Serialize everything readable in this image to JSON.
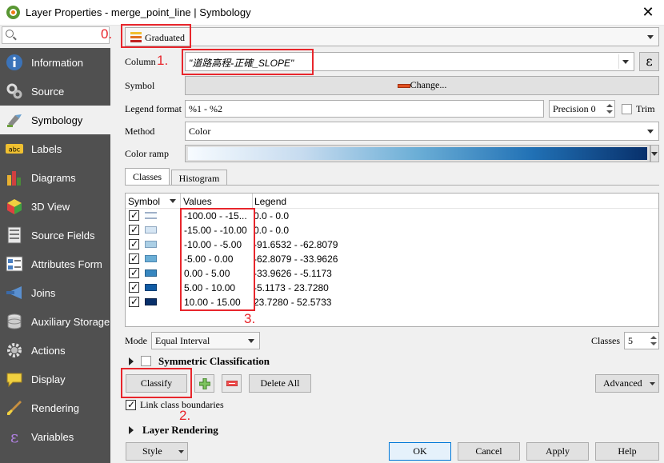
{
  "window": {
    "title": "Layer Properties - merge_point_line | Symbology",
    "close": "✕"
  },
  "search": {
    "placeholder": ""
  },
  "sidebar": {
    "items": [
      {
        "label": "Information",
        "icon": "info-icon"
      },
      {
        "label": "Source",
        "icon": "source-icon"
      },
      {
        "label": "Symbology",
        "icon": "symbology-icon",
        "active": true
      },
      {
        "label": "Labels",
        "icon": "labels-icon"
      },
      {
        "label": "Diagrams",
        "icon": "diagrams-icon"
      },
      {
        "label": "3D View",
        "icon": "cube-icon"
      },
      {
        "label": "Source Fields",
        "icon": "fields-icon"
      },
      {
        "label": "Attributes Form",
        "icon": "form-icon"
      },
      {
        "label": "Joins",
        "icon": "joins-icon"
      },
      {
        "label": "Auxiliary Storage",
        "icon": "storage-icon"
      },
      {
        "label": "Actions",
        "icon": "gear-icon"
      },
      {
        "label": "Display",
        "icon": "display-icon"
      },
      {
        "label": "Rendering",
        "icon": "brush-icon"
      },
      {
        "label": "Variables",
        "icon": "epsilon-icon"
      }
    ]
  },
  "renderer": {
    "type": "Graduated"
  },
  "form": {
    "column_label": "Column",
    "column_value": "\"道路高程-正確_SLOPE\"",
    "symbol_label": "Symbol",
    "symbol_button": "Change...",
    "legend_format_label": "Legend format",
    "legend_format_value": "%1 - %2",
    "precision_label": "Precision 0",
    "trim_label": "Trim",
    "method_label": "Method",
    "method_value": "Color",
    "color_ramp_label": "Color ramp",
    "expr_button": "ε"
  },
  "tabs": {
    "classes": "Classes",
    "histogram": "Histogram"
  },
  "table": {
    "headers": {
      "symbol": "Symbol",
      "values": "Values",
      "legend": "Legend"
    },
    "rows": [
      {
        "values": "-100.00 - -15...",
        "legend": "0.0 - 0.0",
        "color": "#f7fbff"
      },
      {
        "values": "-15.00 - -10.00",
        "legend": "0.0 - 0.0",
        "color": "#d6e6f4"
      },
      {
        "values": "-10.00 - -5.00",
        "legend": "-91.6532 - -62.8079",
        "color": "#abcfe5"
      },
      {
        "values": "-5.00 - 0.00",
        "legend": "-62.8079 - -33.9626",
        "color": "#6aaed6"
      },
      {
        "values": "0.00 - 5.00",
        "legend": "-33.9626 - -5.1173",
        "color": "#3787c0"
      },
      {
        "values": "5.00 - 10.00",
        "legend": "-5.1173 - 23.7280",
        "color": "#105ba4"
      },
      {
        "values": "10.00 - 15.00",
        "legend": "23.7280 - 52.5733",
        "color": "#08306b"
      }
    ]
  },
  "mode": {
    "label": "Mode",
    "value": "Equal Interval"
  },
  "classes": {
    "label": "Classes",
    "value": "5"
  },
  "symmetric": {
    "label": "Symmetric Classification"
  },
  "buttons": {
    "classify": "Classify",
    "add": "+",
    "remove": "−",
    "delete_all": "Delete All",
    "advanced": "Advanced",
    "ok": "OK",
    "cancel": "Cancel",
    "apply": "Apply",
    "help": "Help",
    "style": "Style"
  },
  "link_boundaries": {
    "label": "Link class boundaries"
  },
  "layer_rendering": {
    "label": "Layer Rendering"
  },
  "annotations": [
    "0.",
    "1.",
    "2.",
    "3."
  ],
  "colors": {
    "accent_red": "#e8262c",
    "sidebar_bg": "#505050",
    "ramp_start": "#f7fbff",
    "ramp_end": "#08306b"
  }
}
